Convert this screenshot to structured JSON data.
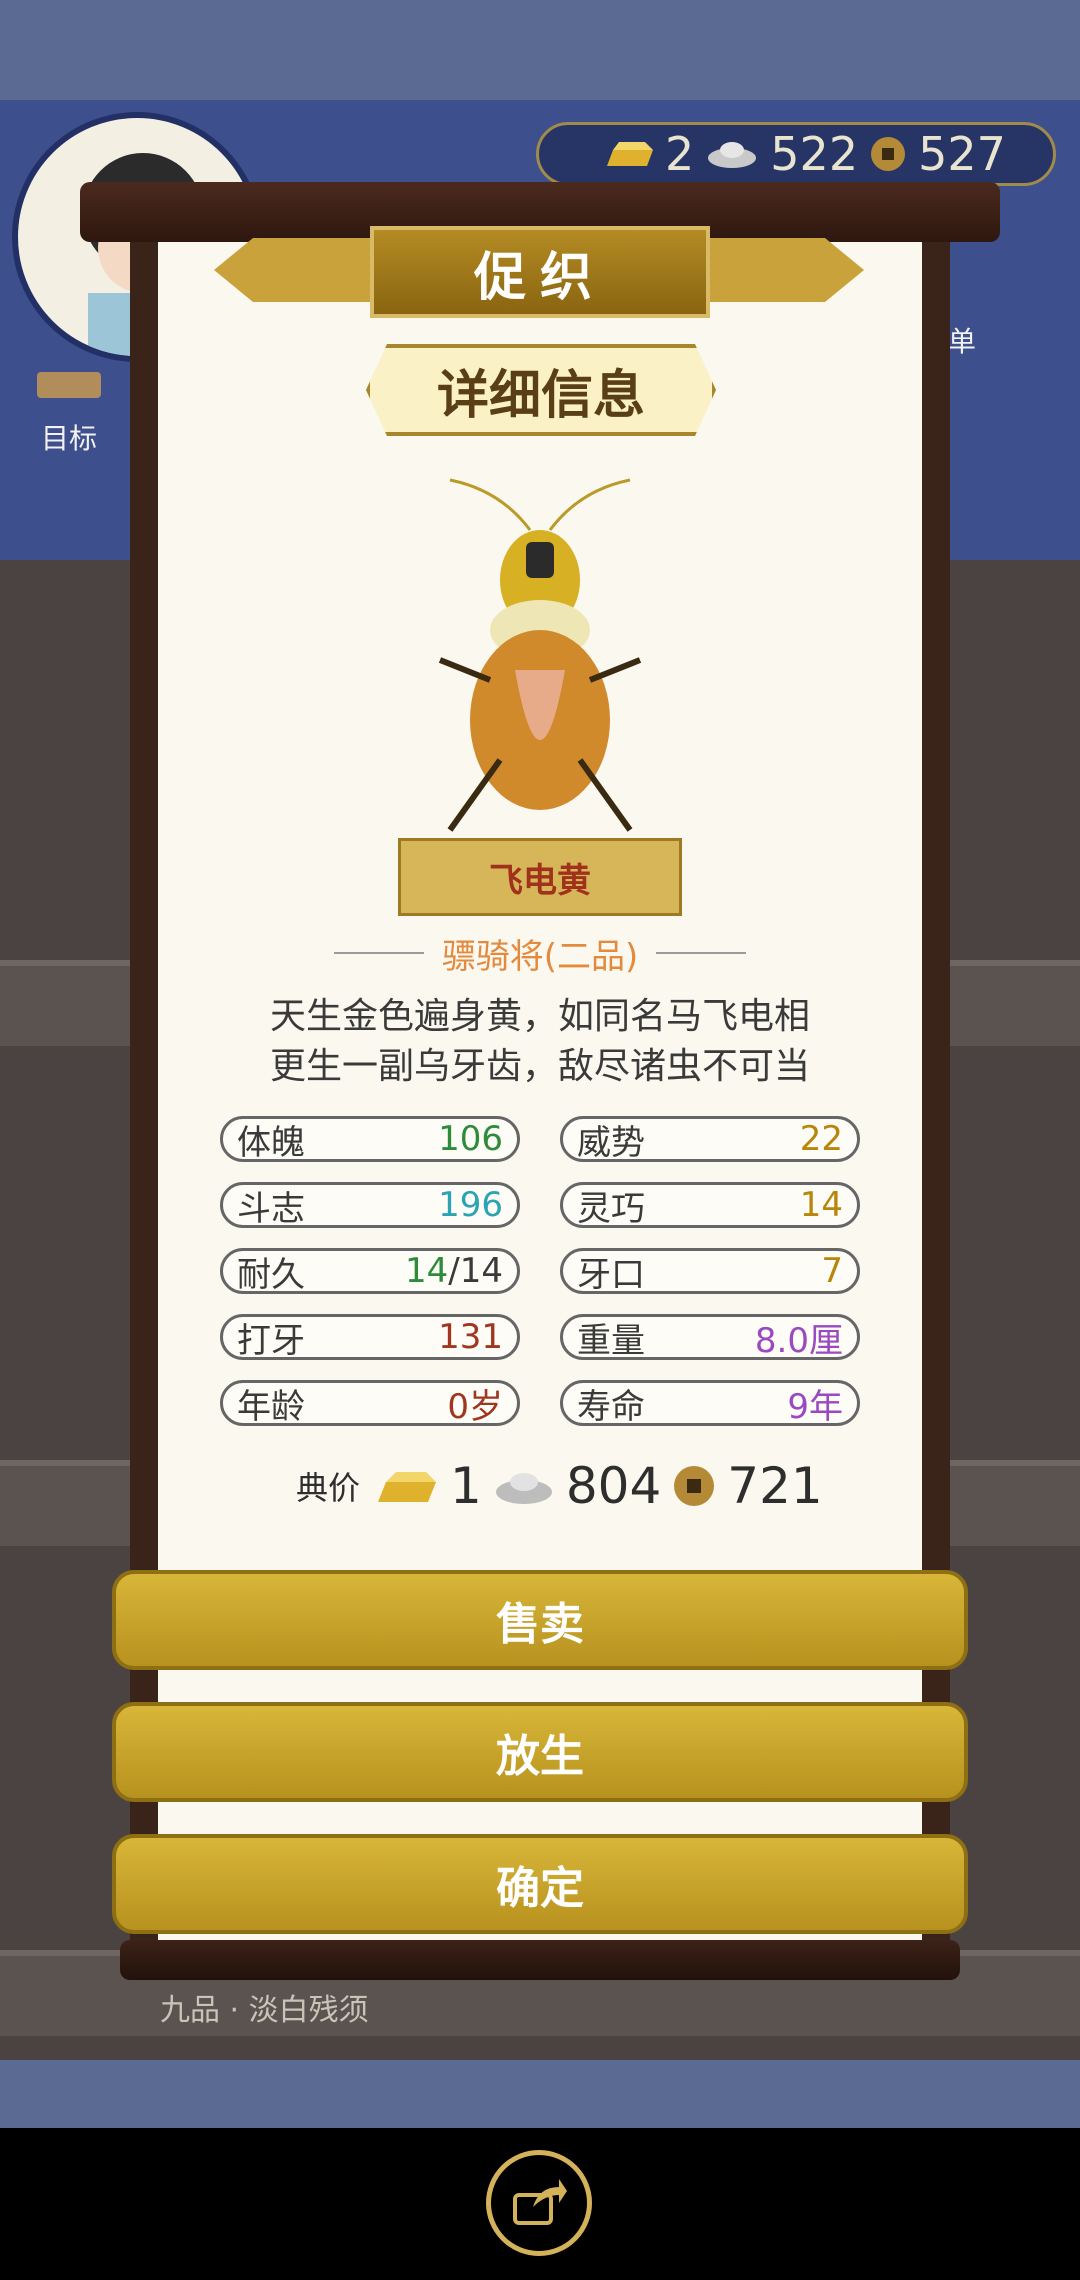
{
  "hud": {
    "currency": {
      "gold": "2",
      "silver": "522",
      "coin": "527"
    },
    "goal_label": "目标",
    "menu_label": "菜单"
  },
  "dialog": {
    "header_title": "促织",
    "section_title": "详细信息",
    "cricket_name": "飞电黄",
    "rank": "骠骑将(二品)",
    "description": [
      "天生金色遍身黄，如同名马飞电相",
      "更生一副乌牙齿，敌尽诸虫不可当"
    ],
    "stats_left": [
      {
        "label": "体魄",
        "value": "106",
        "color": "#2e8b3a"
      },
      {
        "label": "斗志",
        "value": "196",
        "color": "#2aa3b5"
      },
      {
        "label": "耐久",
        "value_a": "14",
        "value_b": "/14",
        "color": "#2e8b3a"
      },
      {
        "label": "打牙",
        "value": "131",
        "color": "#a03520"
      },
      {
        "label": "年龄",
        "value": "0岁",
        "color": "#a03520"
      }
    ],
    "stats_right": [
      {
        "label": "威势",
        "value": "22",
        "color": "#b8860b"
      },
      {
        "label": "灵巧",
        "value": "14",
        "color": "#b8860b"
      },
      {
        "label": "牙口",
        "value": "7",
        "color": "#b8860b"
      },
      {
        "label": "重量",
        "value": "8.0厘",
        "color": "#9b49c0"
      },
      {
        "label": "寿命",
        "value": "9年",
        "color": "#9b49c0"
      }
    ],
    "price": {
      "label": "典价",
      "gold": "1",
      "silver": "804",
      "coin": "721"
    },
    "buttons": {
      "sell": "售卖",
      "release": "放生",
      "confirm": "确定"
    }
  },
  "background": {
    "shelf_caption": "九品 · 淡白残须"
  },
  "colors": {
    "gold_button": "#c9a52c",
    "paper": "#faf8ef",
    "wood": "#3a2419"
  }
}
